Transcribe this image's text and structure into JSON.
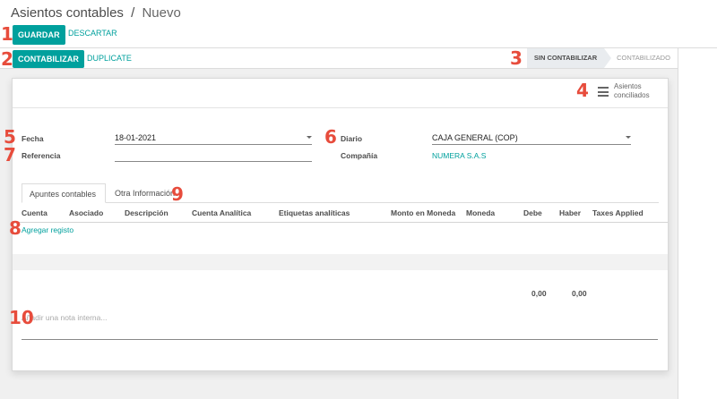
{
  "breadcrumb": {
    "parent": "Asientos contables",
    "separator": "/",
    "current": "Nuevo"
  },
  "control": {
    "save_label": "GUARDAR",
    "discard_label": "DESCARTAR"
  },
  "actions": {
    "post_label": "CONTABILIZAR",
    "duplicate_label": "DUPLICATE"
  },
  "status": {
    "active": "SIN CONTABILIZAR",
    "next": "CONTABILIZADO"
  },
  "smart_button": {
    "line1": "Asientos",
    "line2": "conciliados",
    "icon": "list-icon"
  },
  "form": {
    "date_label": "Fecha",
    "date_value": "18-01-2021",
    "ref_label": "Referencia",
    "ref_value": "",
    "journal_label": "Diario",
    "journal_value": "CAJA GENERAL (COP)",
    "company_label": "Compañía",
    "company_value": "NUMERA S.A.S"
  },
  "tabs": [
    "Apuntes contables",
    "Otra Información"
  ],
  "table": {
    "columns": [
      "Cuenta",
      "Asociado",
      "Descripción",
      "Cuenta Analítica",
      "Etiquetas analíticas",
      "Monto en Moneda",
      "Moneda",
      "Debe",
      "Haber",
      "Taxes Applied"
    ],
    "add_line": "Agregar registo",
    "totals": {
      "debit": "0,00",
      "credit": "0,00"
    }
  },
  "note_placeholder": "Añadir una nota interna...",
  "annotations": [
    "1",
    "2",
    "3",
    "4",
    "5",
    "6",
    "7",
    "8",
    "9",
    "10"
  ],
  "colors": {
    "accent": "#00A09D",
    "annotation": "#e74c3c"
  }
}
